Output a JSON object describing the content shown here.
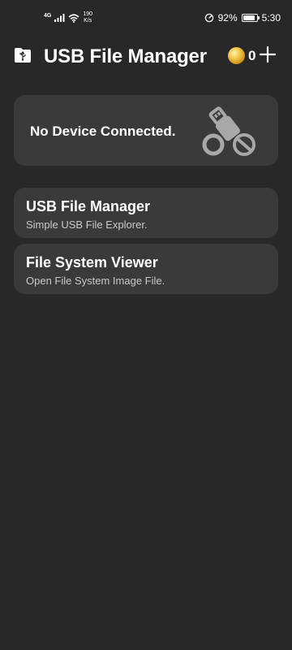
{
  "status_bar": {
    "network_type": "4G",
    "speed_value": "190",
    "speed_unit": "K/s",
    "battery_percent": "92%",
    "battery_level": 0.92,
    "time": "5:30"
  },
  "app_bar": {
    "title": "USB File Manager",
    "coin_count": "0",
    "icons": {
      "app": "usb-folder-icon",
      "coin": "coin-icon",
      "add": "plus-icon"
    }
  },
  "device_card": {
    "message": "No Device Connected.",
    "icon": "usb-disconnected-icon"
  },
  "menu": [
    {
      "title": "USB File Manager",
      "subtitle": "Simple USB File Explorer."
    },
    {
      "title": "File System Viewer",
      "subtitle": "Open File System Image File."
    }
  ],
  "colors": {
    "background": "#282828",
    "card": "#3a3a3a",
    "text": "#ffffff",
    "subtext": "#c9c9c9",
    "icon_gray": "#a8a8a8"
  }
}
